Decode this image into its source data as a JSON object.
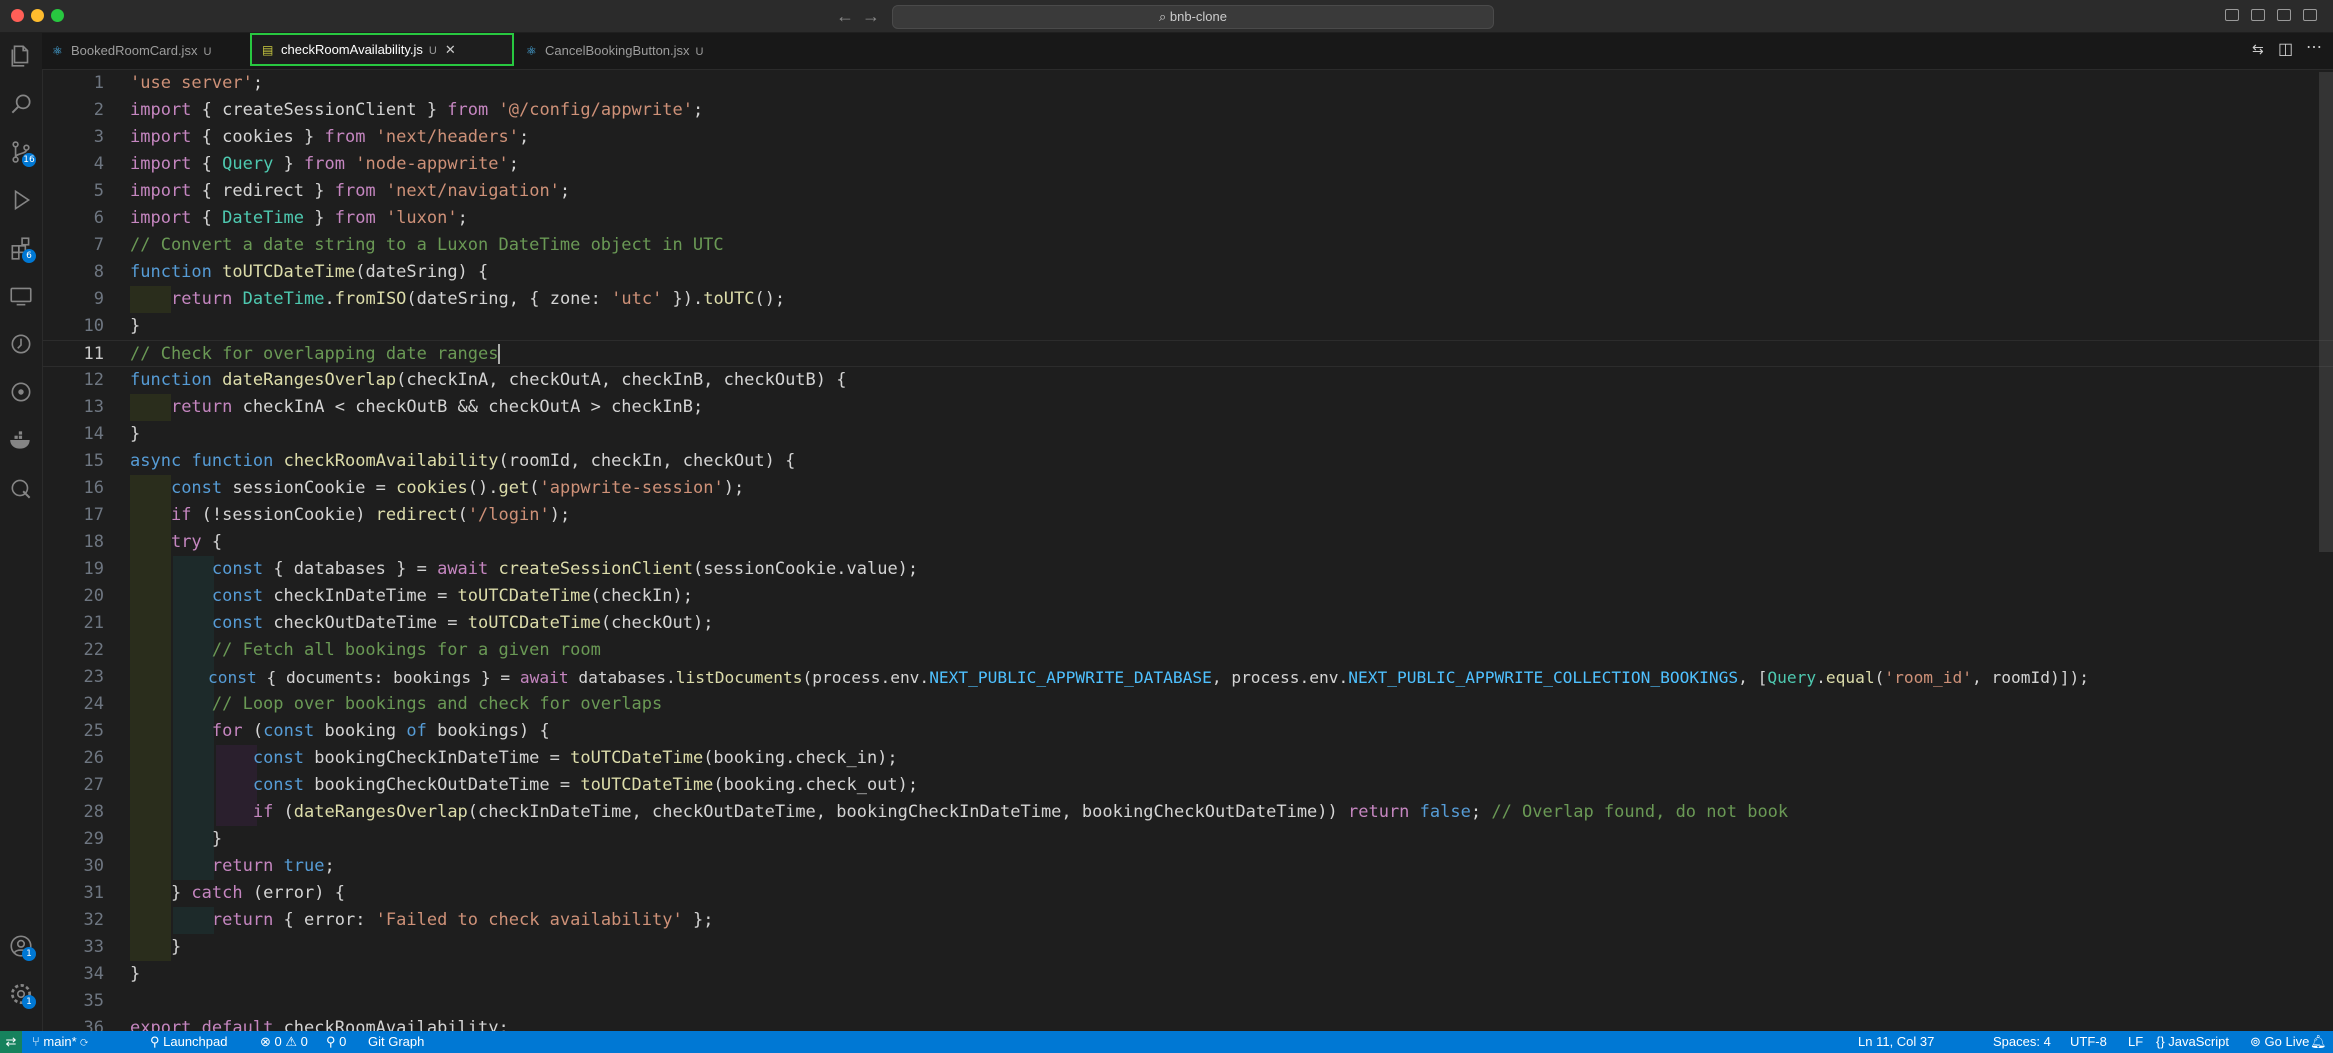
{
  "window": {
    "search": "bnb-clone"
  },
  "tabs": [
    {
      "label": "BookedRoomCard.jsx",
      "modified": "U",
      "icon": "react-icon"
    },
    {
      "label": "checkRoomAvailability.js",
      "modified": "U",
      "icon": "js-icon"
    },
    {
      "label": "CancelBookingButton.jsx",
      "modified": "U",
      "icon": "react-icon"
    }
  ],
  "activity": {
    "scm_badge": "16",
    "extensions_badge": "6",
    "accounts_badge": "1",
    "settings_badge": "1"
  },
  "code_lines": [
    "'use server';",
    "import { createSessionClient } from '@/config/appwrite';",
    "import { cookies } from 'next/headers';",
    "import { Query } from 'node-appwrite';",
    "import { redirect } from 'next/navigation';",
    "import { DateTime } from 'luxon';",
    "// Convert a date string to a Luxon DateTime object in UTC",
    "function toUTCDateTime(dateSring) {",
    "    return DateTime.fromISO(dateSring, { zone: 'utc' }).toUTC();",
    "}",
    "// Check for overlapping date ranges",
    "function dateRangesOverlap(checkInA, checkOutA, checkInB, checkOutB) {",
    "    return checkInA < checkOutB && checkOutA > checkInB;",
    "}",
    "async function checkRoomAvailability(roomId, checkIn, checkOut) {",
    "    const sessionCookie = cookies().get('appwrite-session');",
    "    if (!sessionCookie) redirect('/login');",
    "    try {",
    "        const { databases } = await createSessionClient(sessionCookie.value);",
    "        const checkInDateTime = toUTCDateTime(checkIn);",
    "        const checkOutDateTime = toUTCDateTime(checkOut);",
    "        // Fetch all bookings for a given room",
    "        const { documents: bookings } = await databases.listDocuments(process.env.NEXT_PUBLIC_APPWRITE_DATABASE, process.env.NEXT_PUBLIC_APPWRITE_COLLECTION_BOOKINGS, [Query.equal('room_id', roomId)]);",
    "        // Loop over bookings and check for overlaps",
    "        for (const booking of bookings) {",
    "            const bookingCheckInDateTime = toUTCDateTime(booking.check_in);",
    "            const bookingCheckOutDateTime = toUTCDateTime(booking.check_out);",
    "            if (dateRangesOverlap(checkInDateTime, checkOutDateTime, bookingCheckInDateTime, bookingCheckOutDateTime)) return false; // Overlap found, do not book",
    "        }",
    "        return true;",
    "    } catch (error) {",
    "        return { error: 'Failed to check availability' };",
    "    }",
    "}",
    "",
    "export default checkRoomAvailability;"
  ],
  "status": {
    "branch": "main*",
    "launchpad": "Launchpad",
    "errors": "0",
    "warnings": "0",
    "ports": "0",
    "git_graph": "Git Graph",
    "position": "Ln 11, Col 37",
    "spaces": "Spaces: 4",
    "encoding": "UTF-8",
    "eol": "LF",
    "language": "JavaScript",
    "golive": "Go Live"
  }
}
